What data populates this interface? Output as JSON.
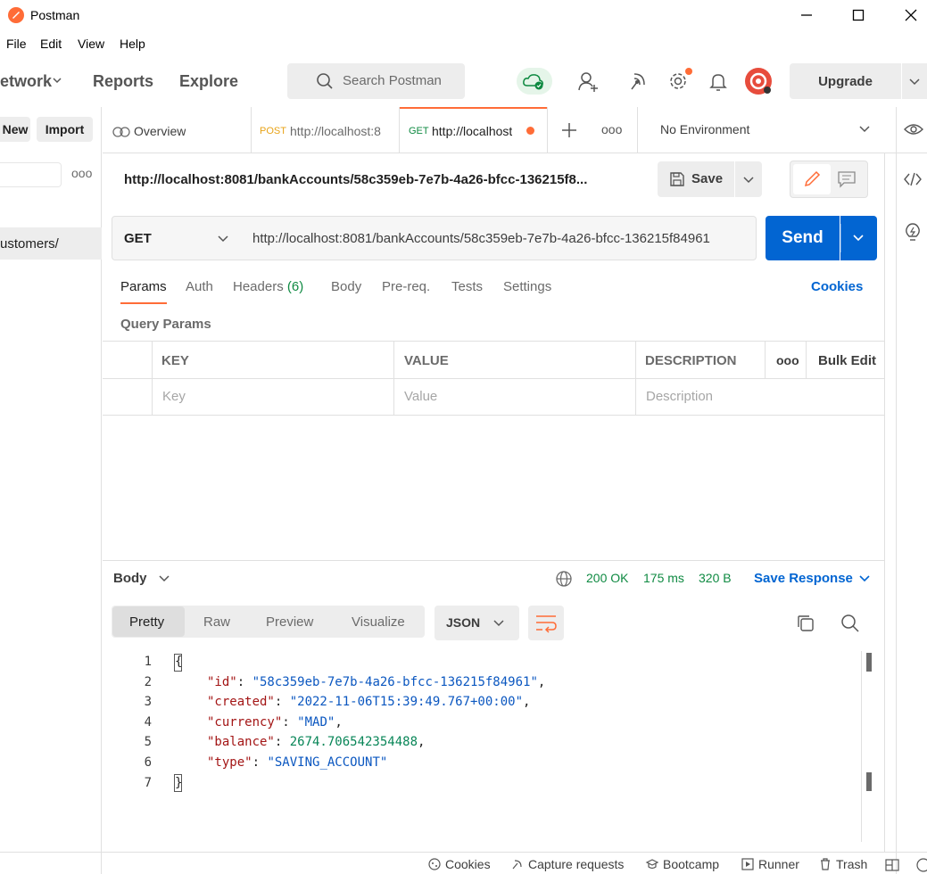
{
  "window": {
    "title": "Postman"
  },
  "menu": [
    "File",
    "Edit",
    "View",
    "Help"
  ],
  "header": {
    "nav_network": "etwork",
    "nav_reports": "Reports",
    "nav_explore": "Explore",
    "search_placeholder": "Search Postman",
    "upgrade_label": "Upgrade"
  },
  "sidebar": {
    "new_label": "New",
    "import_label": "Import",
    "more_label": "ooo",
    "item_label": "ustomers/"
  },
  "tabs": {
    "overview": "Overview",
    "tab1_method": "POST",
    "tab1_url": "http://localhost:8",
    "tab2_method": "GET",
    "tab2_url": "http://localhost",
    "more": "ooo",
    "environment": "No Environment"
  },
  "request": {
    "title": "http://localhost:8081/bankAccounts/58c359eb-7e7b-4a26-bfcc-136215f8...",
    "save_label": "Save",
    "method": "GET",
    "url": "http://localhost:8081/bankAccounts/58c359eb-7e7b-4a26-bfcc-136215f84961",
    "send_label": "Send",
    "subtabs": [
      "Params",
      "Auth",
      "Headers",
      "Body",
      "Pre-req.",
      "Tests",
      "Settings"
    ],
    "headers_count": "(6)",
    "cookies_label": "Cookies",
    "query_params_title": "Query Params"
  },
  "params_table": {
    "headers": [
      "KEY",
      "VALUE",
      "DESCRIPTION"
    ],
    "bulk_edit": "Bulk Edit",
    "more": "ooo",
    "placeholders": [
      "Key",
      "Value",
      "Description"
    ]
  },
  "response": {
    "body_label": "Body",
    "status": "200 OK",
    "time": "175 ms",
    "size": "320 B",
    "save_response": "Save Response",
    "view_tabs": [
      "Pretty",
      "Raw",
      "Preview",
      "Visualize"
    ],
    "format": "JSON",
    "lines": [
      {
        "n": "1",
        "text": "{"
      },
      {
        "n": "2",
        "key": "\"id\"",
        "val": "\"58c359eb-7e7b-4a26-bfcc-136215f84961\"",
        "type": "s",
        "tail": ","
      },
      {
        "n": "3",
        "key": "\"created\"",
        "val": "\"2022-11-06T15:39:49.767+00:00\"",
        "type": "s",
        "tail": ","
      },
      {
        "n": "4",
        "key": "\"currency\"",
        "val": "\"MAD\"",
        "type": "s",
        "tail": ","
      },
      {
        "n": "5",
        "key": "\"balance\"",
        "val": "2674.706542354488",
        "type": "n",
        "tail": ","
      },
      {
        "n": "6",
        "key": "\"type\"",
        "val": "\"SAVING_ACCOUNT\"",
        "type": "s",
        "tail": ""
      },
      {
        "n": "7",
        "text": "}"
      }
    ]
  },
  "statusbar": [
    "Cookies",
    "Capture requests",
    "Bootcamp",
    "Runner",
    "Trash"
  ],
  "colors": {
    "accent": "#ff6c37",
    "send": "#0265d2",
    "status_ok": "#0f8a42"
  }
}
